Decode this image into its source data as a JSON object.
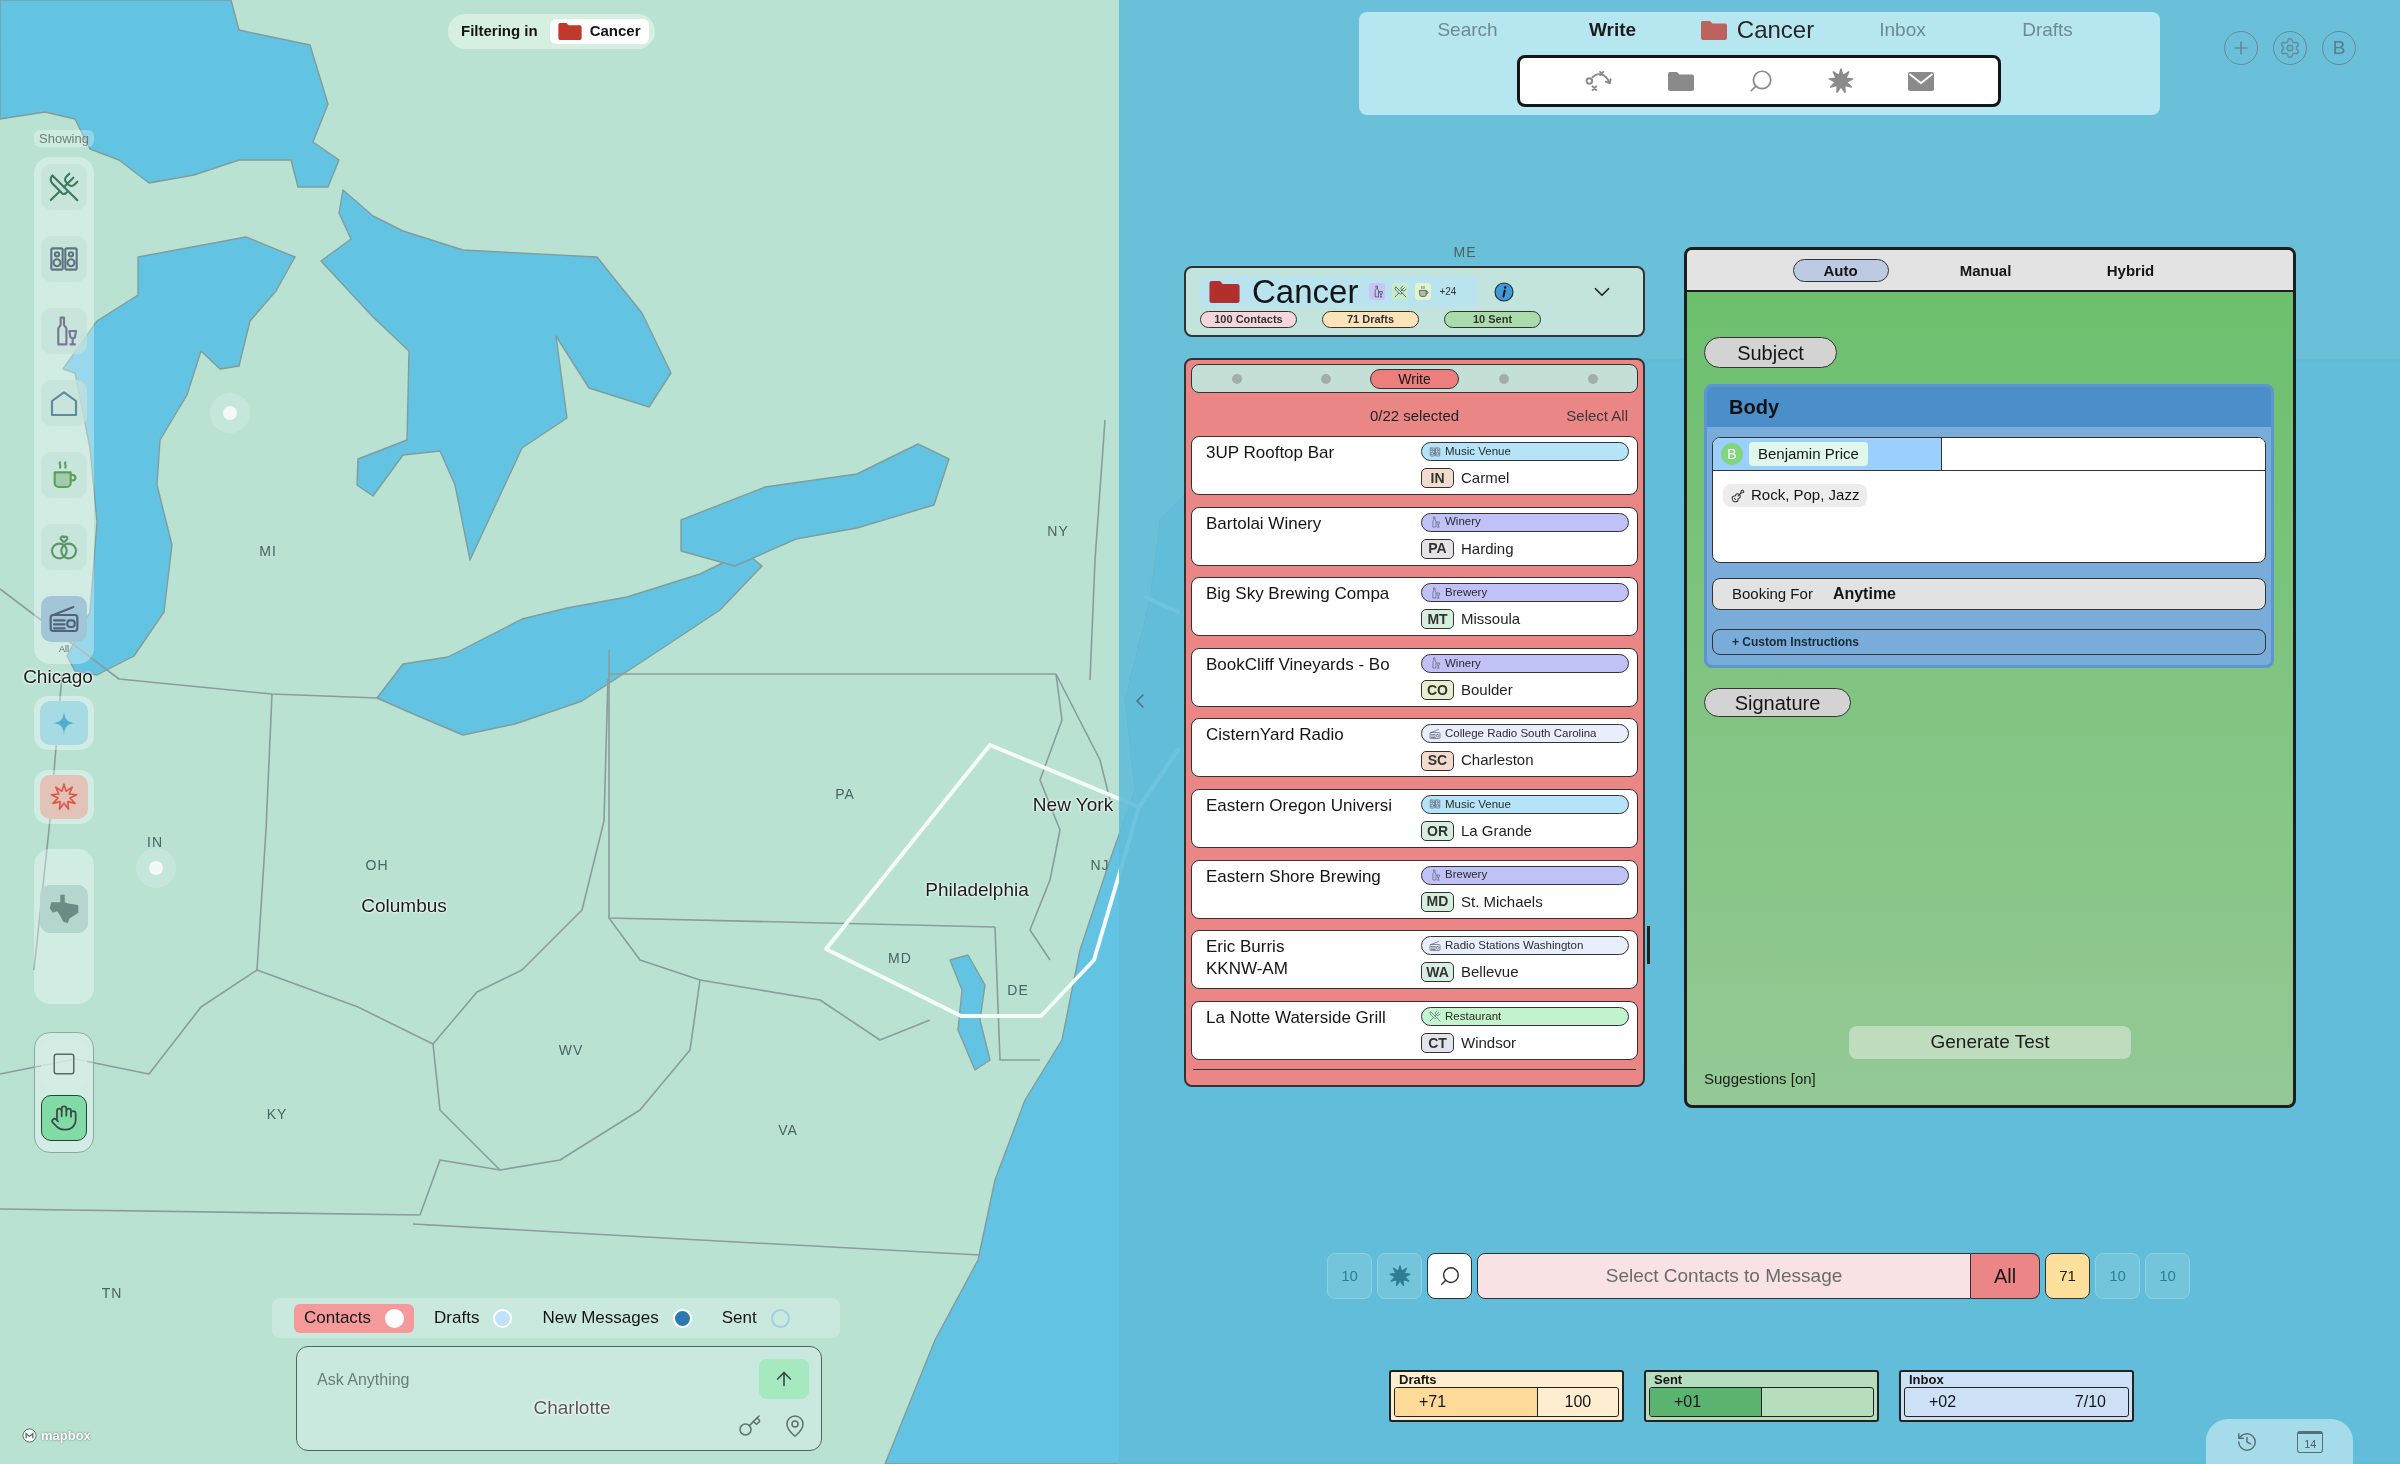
{
  "map": {
    "labels": [
      {
        "text": "MI",
        "kind": "state"
      },
      {
        "text": "NY",
        "kind": "state"
      },
      {
        "text": "ME",
        "kind": "state"
      },
      {
        "text": "Chicago",
        "kind": "city"
      },
      {
        "text": "PA",
        "kind": "state"
      },
      {
        "text": "New York",
        "kind": "city"
      },
      {
        "text": "IN",
        "kind": "state"
      },
      {
        "text": "OH",
        "kind": "state"
      },
      {
        "text": "Columbus",
        "kind": "city"
      },
      {
        "text": "Philadelphia",
        "kind": "city"
      },
      {
        "text": "NJ",
        "kind": "state"
      },
      {
        "text": "MD",
        "kind": "state"
      },
      {
        "text": "DE",
        "kind": "state"
      },
      {
        "text": "WV",
        "kind": "state"
      },
      {
        "text": "KY",
        "kind": "state"
      },
      {
        "text": "VA",
        "kind": "state"
      },
      {
        "text": "TN",
        "kind": "state"
      },
      {
        "text": "Charlotte",
        "kind": "city"
      }
    ],
    "attribution": "mapbox"
  },
  "filter": {
    "label": "Filtering in",
    "folder": "Cancer"
  },
  "sidebar": {
    "title": "Showing",
    "categories": [
      {
        "kind": "restaurant",
        "selected": false
      },
      {
        "kind": "music_venue",
        "selected": false
      },
      {
        "kind": "winery",
        "selected": false
      },
      {
        "kind": "venue",
        "selected": false
      },
      {
        "kind": "cafe",
        "selected": false
      },
      {
        "kind": "wedding",
        "selected": false
      },
      {
        "kind": "radio",
        "selected": true
      }
    ],
    "all_label": "All",
    "modes": [
      {
        "kind": "select",
        "selected": false
      },
      {
        "kind": "pan",
        "selected": true
      }
    ]
  },
  "nav": {
    "tabs": [
      {
        "label": "Search",
        "kind": "text",
        "selected": false
      },
      {
        "label": "Write",
        "kind": "text",
        "selected": true
      },
      {
        "label": "Cancer",
        "kind": "folder",
        "selected": false
      },
      {
        "label": "Inbox",
        "kind": "text",
        "selected": false
      },
      {
        "label": "Drafts",
        "kind": "text",
        "selected": false
      }
    ]
  },
  "account": {
    "initial": "B"
  },
  "folder_card": {
    "name": "Cancer",
    "tags": [
      {
        "kind": "winery"
      },
      {
        "kind": "restaurant"
      },
      {
        "kind": "cafe"
      }
    ],
    "more_tags": "+24",
    "chips": [
      {
        "label": "100 Contacts",
        "color": "#f4d6dc"
      },
      {
        "label": "71 Drafts",
        "color": "#fde3b9"
      },
      {
        "label": "10 Sent",
        "color": "#a9dcaa"
      }
    ]
  },
  "contact_list": {
    "pages": [
      {
        "selected": false
      },
      {
        "selected": false
      },
      {
        "label": "Write",
        "selected": true
      },
      {
        "selected": false
      },
      {
        "selected": false
      }
    ],
    "selection_count": "0/22 selected",
    "select_all": "Select All",
    "contacts": [
      {
        "name": "3UP Rooftop Bar",
        "tag": {
          "label": "Music Venue",
          "kind": "music_venue",
          "color": "#b5e3f8"
        },
        "state": {
          "code": "IN",
          "color": "#f3dccd"
        },
        "city": "Carmel"
      },
      {
        "name": "Bartolai Winery",
        "tag": {
          "label": "Winery",
          "kind": "winery",
          "color": "#bfc1f7"
        },
        "state": {
          "code": "PA",
          "color": "#e6e1e7"
        },
        "city": "Harding"
      },
      {
        "name": "Big Sky Brewing Compa",
        "tag": {
          "label": "Brewery",
          "kind": "brewery",
          "color": "#bfc1f7"
        },
        "state": {
          "code": "MT",
          "color": "#d6efdd"
        },
        "city": "Missoula"
      },
      {
        "name": "BookCliff Vineyards - Bo",
        "tag": {
          "label": "Winery",
          "kind": "winery",
          "color": "#bfc1f7"
        },
        "state": {
          "code": "CO",
          "color": "#e8efcf"
        },
        "city": "Boulder"
      },
      {
        "name": "CisternYard Radio",
        "tag": {
          "label": "College Radio South Carolina",
          "kind": "radio",
          "color": "#e8eefb"
        },
        "state": {
          "code": "SC",
          "color": "#f3dccd"
        },
        "city": "Charleston"
      },
      {
        "name": "Eastern Oregon Universi",
        "tag": {
          "label": "Music Venue",
          "kind": "music_venue",
          "color": "#b5e3f8"
        },
        "state": {
          "code": "OR",
          "color": "#d6efdd"
        },
        "city": "La Grande"
      },
      {
        "name": "Eastern Shore Brewing",
        "tag": {
          "label": "Brewery",
          "kind": "brewery",
          "color": "#bfc1f7"
        },
        "state": {
          "code": "MD",
          "color": "#d6efdd"
        },
        "city": "St. Michaels"
      },
      {
        "name": "Eric Burris\nKKNW-AM",
        "tag": {
          "label": "Radio Stations Washington",
          "kind": "radio",
          "color": "#e8eefb"
        },
        "state": {
          "code": "WA",
          "color": "#d9eee2"
        },
        "city": "Bellevue"
      },
      {
        "name": "La Notte Waterside Grill",
        "tag": {
          "label": "Restaurant",
          "kind": "restaurant",
          "color": "#c3f4cd"
        },
        "state": {
          "code": "CT",
          "color": "#e1e5eb"
        },
        "city": "Windsor"
      }
    ]
  },
  "compose": {
    "modes": [
      {
        "label": "Auto",
        "selected": true
      },
      {
        "label": "Manual",
        "selected": false
      },
      {
        "label": "Hybrid",
        "selected": false
      }
    ],
    "subject": "Subject",
    "body": {
      "title": "Body",
      "recipient": {
        "initial": "B",
        "name": "Benjamin Price"
      },
      "genres": "Rock, Pop, Jazz",
      "booking_label": "Booking For",
      "booking_value": "Anytime",
      "custom_instructions": "+ Custom Instructions"
    },
    "signature": "Signature",
    "generate": "Generate Test",
    "suggestions": "Suggestions [on]"
  },
  "legend": {
    "items": [
      {
        "label": "Contacts",
        "selected": true,
        "color": "#ffffff",
        "filled": true
      },
      {
        "label": "Drafts",
        "selected": false,
        "color": "#bfe2fa",
        "filled": true
      },
      {
        "label": "New Messages",
        "selected": false,
        "color": "#2b79b3",
        "filled": true
      },
      {
        "label": "Sent",
        "selected": false,
        "color": "#a3cfe0",
        "filled": false
      }
    ]
  },
  "ask": {
    "placeholder": "Ask Anything"
  },
  "message_bar": {
    "leading": [
      {
        "kind": "count",
        "label": "10",
        "disabled": true
      },
      {
        "kind": "burst",
        "disabled": true
      },
      {
        "kind": "search",
        "disabled": false
      }
    ],
    "placeholder": "Select Contacts to Message",
    "filter": "All",
    "trailing": [
      {
        "kind": "count",
        "label": "71",
        "disabled": false
      },
      {
        "kind": "count",
        "label": "10",
        "disabled": true
      },
      {
        "kind": "count",
        "label": "10",
        "disabled": true
      }
    ]
  },
  "stats": [
    {
      "title": "Drafts",
      "color": "#fdda98",
      "level": 0.64,
      "count": "+71",
      "total": "100"
    },
    {
      "title": "Sent",
      "color": "#5ab46f",
      "level": 0.5,
      "count": "+01"
    },
    {
      "title": "Inbox",
      "color": "#cde0f6",
      "count": "+02",
      "total": "7/10"
    }
  ],
  "corner": {
    "calendar_day": "14"
  }
}
